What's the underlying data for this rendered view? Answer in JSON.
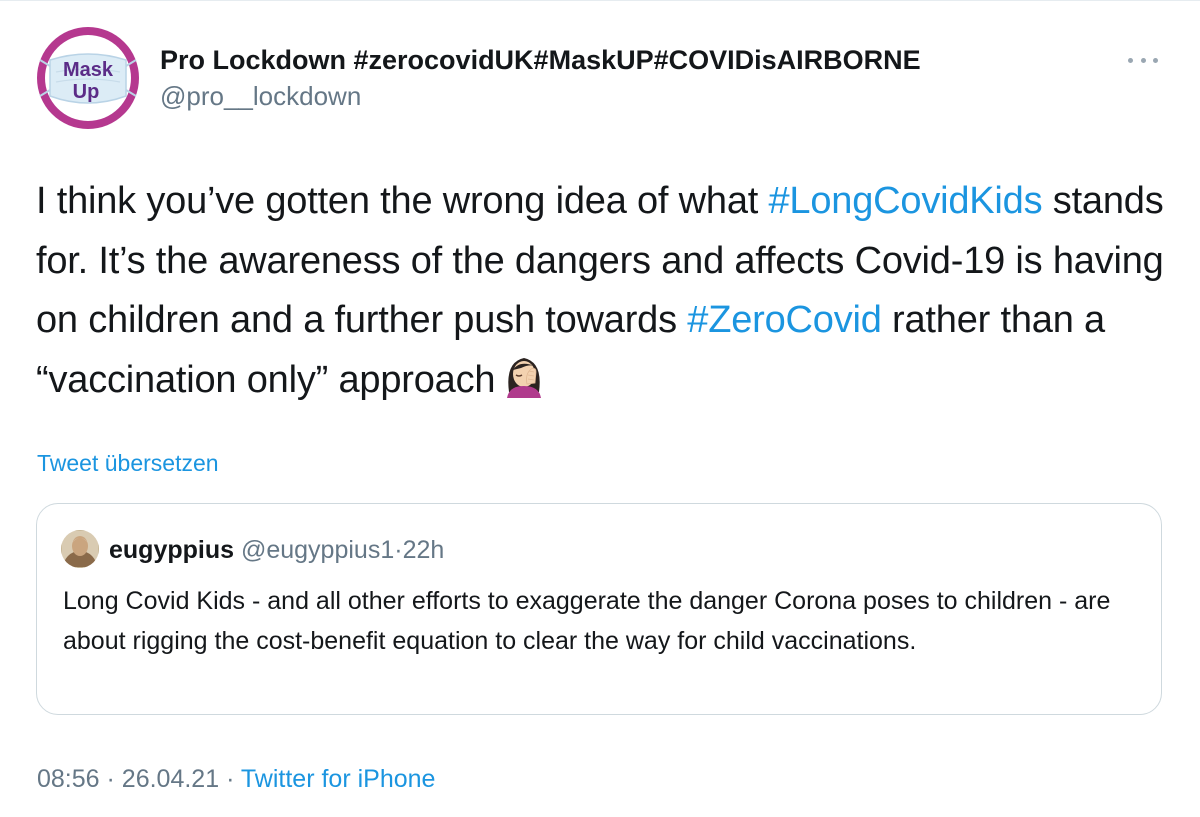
{
  "tweet": {
    "author": {
      "display_name": "Pro Lockdown #zerocovidUK#MaskUP#COVIDisAIRBORNE",
      "handle": "@pro__lockdown",
      "avatar_text_line1": "Mask",
      "avatar_text_line2": "Up",
      "avatar_ring_color": "#b5388f",
      "avatar_text_color": "#5b2c87"
    },
    "more_icon": "more-horizontal-icon",
    "text_segments": {
      "part1": "I think you’ve gotten the wrong idea of what ",
      "hashtag1": "#LongCovidKids",
      "part2": " stands for. It’s the awareness of the dangers and affects Covid-19 is having on children and a further push towards ",
      "hashtag2": "#ZeroCovid",
      "part3": " rather than a “vaccination only” approach",
      "emoji": "woman-facepalming-icon"
    },
    "translate_label": "Tweet übersetzen",
    "quoted_tweet": {
      "display_name": "eugyppius",
      "handle": "@eugyppius1",
      "separator": "·",
      "time": "22h",
      "text": "Long Covid Kids - and all other efforts to exaggerate the danger Corona poses to children - are about rigging the cost-benefit equation to clear the way for child vaccinations."
    },
    "footer": {
      "time": "08:56",
      "sep1": "·",
      "date": "26.04.21",
      "sep2": "·",
      "source": "Twitter for iPhone"
    },
    "colors": {
      "link": "#1b95e0",
      "secondary_text": "#657786",
      "primary_text": "#14171a",
      "border": "#cfd9de"
    }
  }
}
